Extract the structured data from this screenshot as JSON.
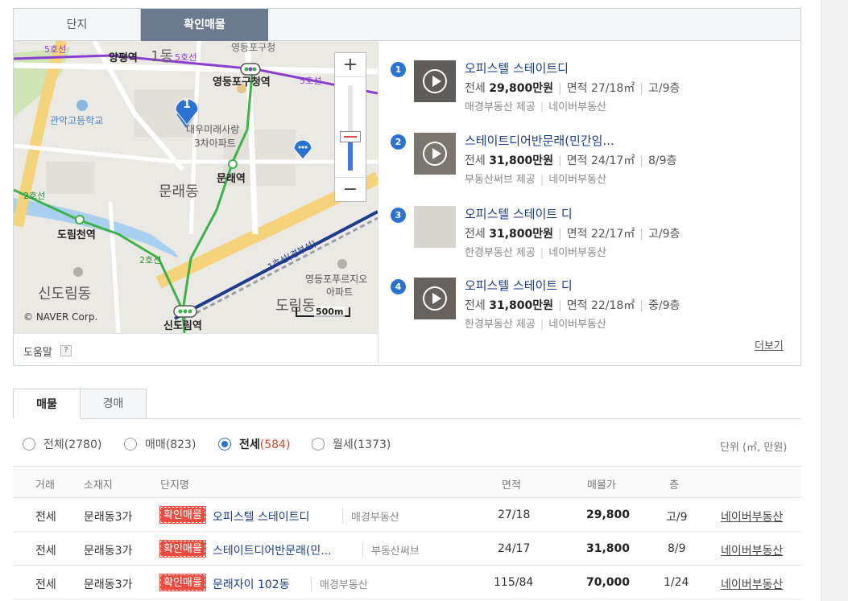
{
  "panel_tabs": [
    {
      "label": "단지"
    },
    {
      "label": "확인매물",
      "active": true
    }
  ],
  "map": {
    "labels": {
      "yangpyeong": "양평역",
      "yangpyeong_dong": "1동",
      "yeongdeungpo_gucheong": "영등포구청역",
      "yeongdeungpo_top": "영등포구청",
      "gwanak_high": "관악고등학교",
      "daewoo_apt_1": "대우미래사랑",
      "daewoo_apt_2": "3차아파트",
      "mullae_station": "문래역",
      "mullae_dong": "문래동",
      "dorimcheon": "도림천역",
      "sindorim_dong": "신도림동",
      "sindorim_station": "신도림역",
      "dorim_dong": "도림동",
      "yeongdeungpo_prugio_1": "영등포푸르지오",
      "yeongdeungpo_prugio_2": "아파트",
      "line_2_a": "2호선",
      "line_2_b": "2호선",
      "line_5_a": "5호선",
      "line_5_b": "5호선",
      "line_5_c": "5호선",
      "line_1": "1호선(경부선)",
      "marker_1": "1"
    },
    "copyright": "© NAVER Corp.",
    "scale": "500m",
    "zoom_plus": "+",
    "zoom_minus": "−",
    "zoom_level": 0.4,
    "help": "도움말",
    "help_icon": "?"
  },
  "listings": [
    {
      "num": "1",
      "title": "오피스텔 스테이트디",
      "type": "전세",
      "price": "29,800만원",
      "area": "면적 27/18㎡",
      "floor": "고/9층",
      "provider": "매경부동산 제공",
      "platform": "네이버부동산"
    },
    {
      "num": "2",
      "title": "스테이트디어반문래(민간임...",
      "type": "전세",
      "price": "31,800만원",
      "area": "면적 24/17㎡",
      "floor": "8/9층",
      "provider": "부동산써브 제공",
      "platform": "네이버부동산"
    },
    {
      "num": "3",
      "title": "오피스텔 스테이트 디",
      "type": "전세",
      "price": "31,800만원",
      "area": "면적 22/17㎡",
      "floor": "고/9층",
      "provider": "한경부동산 제공",
      "platform": "네이버부동산"
    },
    {
      "num": "4",
      "title": "오피스텔 스테이트 디",
      "type": "전세",
      "price": "31,800만원",
      "area": "면적 22/18㎡",
      "floor": "중/9층",
      "provider": "한경부동산 제공",
      "platform": "네이버부동산"
    }
  ],
  "more": "더보기",
  "tabs2": [
    {
      "label": "매물",
      "active": true
    },
    {
      "label": "경매"
    }
  ],
  "filters": [
    {
      "label": "전체",
      "count": "(2780)"
    },
    {
      "label": "매매",
      "count": "(823)"
    },
    {
      "label": "전세",
      "count": "(584)",
      "selected": true
    },
    {
      "label": "월세",
      "count": "(1373)"
    }
  ],
  "unit": "단위 (㎡, 만원)",
  "table": {
    "headers": [
      "거래",
      "소재지",
      "단지명",
      "면적",
      "매물가",
      "층"
    ],
    "rows": [
      {
        "deal": "전세",
        "location": "문래동3가",
        "badge": "확인매물",
        "name": "오피스텔 스테이트디",
        "agent": "매경부동산",
        "area": "27/18",
        "price": "29,800",
        "floor": "고/9",
        "link": "네이버부동산"
      },
      {
        "deal": "전세",
        "location": "문래동3가",
        "badge": "확인매물",
        "name": "스테이트디어반문래(민...",
        "agent": "부동산써브",
        "area": "24/17",
        "price": "31,800",
        "floor": "8/9",
        "link": "네이버부동산"
      },
      {
        "deal": "전세",
        "location": "문래동3가",
        "badge": "확인매물",
        "name": "문래자이 102동",
        "agent": "매경부동산",
        "area": "115/84",
        "price": "70,000",
        "floor": "1/24",
        "link": "네이버부동산"
      }
    ]
  },
  "colors": {
    "accent": "#2b73d2",
    "tab_active": "#6c7a8f",
    "badge": "#ea4c3f",
    "line_2": "#3bb34a",
    "line_5": "#8a3fd1",
    "line_1": "#1f3b8f"
  }
}
